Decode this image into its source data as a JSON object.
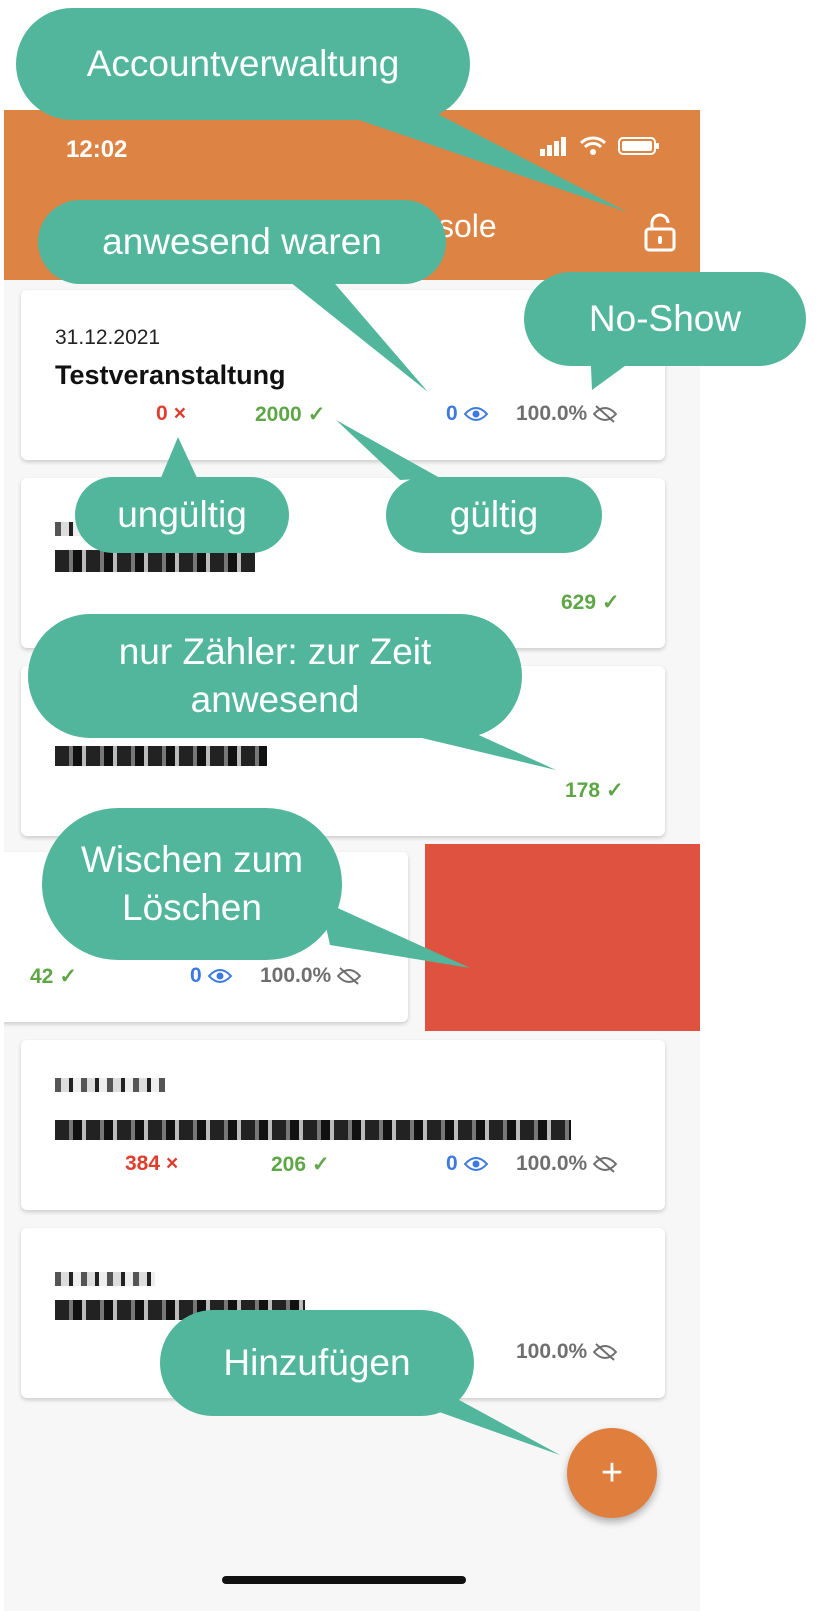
{
  "status_bar": {
    "time": "12:02"
  },
  "app_bar": {
    "title": "sole"
  },
  "cards": [
    {
      "date": "31.12.2021",
      "name": "Testveranstaltung",
      "invalid": "0",
      "valid": "2000",
      "present": "0",
      "noshow": "100.0%"
    },
    {
      "valid": "629"
    },
    {
      "valid": "178"
    },
    {
      "valid": "42",
      "present": "0",
      "noshow": "100.0%"
    },
    {
      "invalid": "384",
      "valid": "206",
      "present": "0",
      "noshow": "100.0%"
    },
    {
      "noshow": "100.0%"
    }
  ],
  "fab": {
    "label": "+"
  },
  "callouts": {
    "account": "Accountverwaltung",
    "present": "anwesend waren",
    "noshow": "No-Show",
    "invalid": "ungültig",
    "valid": "gültig",
    "counter": "nur Zähler: zur Zeit anwesend",
    "swipe": "Wischen zum Löschen",
    "add": "Hinzufügen"
  },
  "colors": {
    "appbar": "#dd8344",
    "callout": "#52b69c",
    "invalid": "#df3e2e",
    "valid": "#5ea646",
    "present": "#3c7ae0",
    "delete": "#e05240"
  },
  "icons": [
    "signal-icon",
    "wifi-icon",
    "battery-icon",
    "lock-icon",
    "cross-icon",
    "check-icon",
    "eye-icon",
    "eye-off-icon",
    "plus-icon"
  ]
}
